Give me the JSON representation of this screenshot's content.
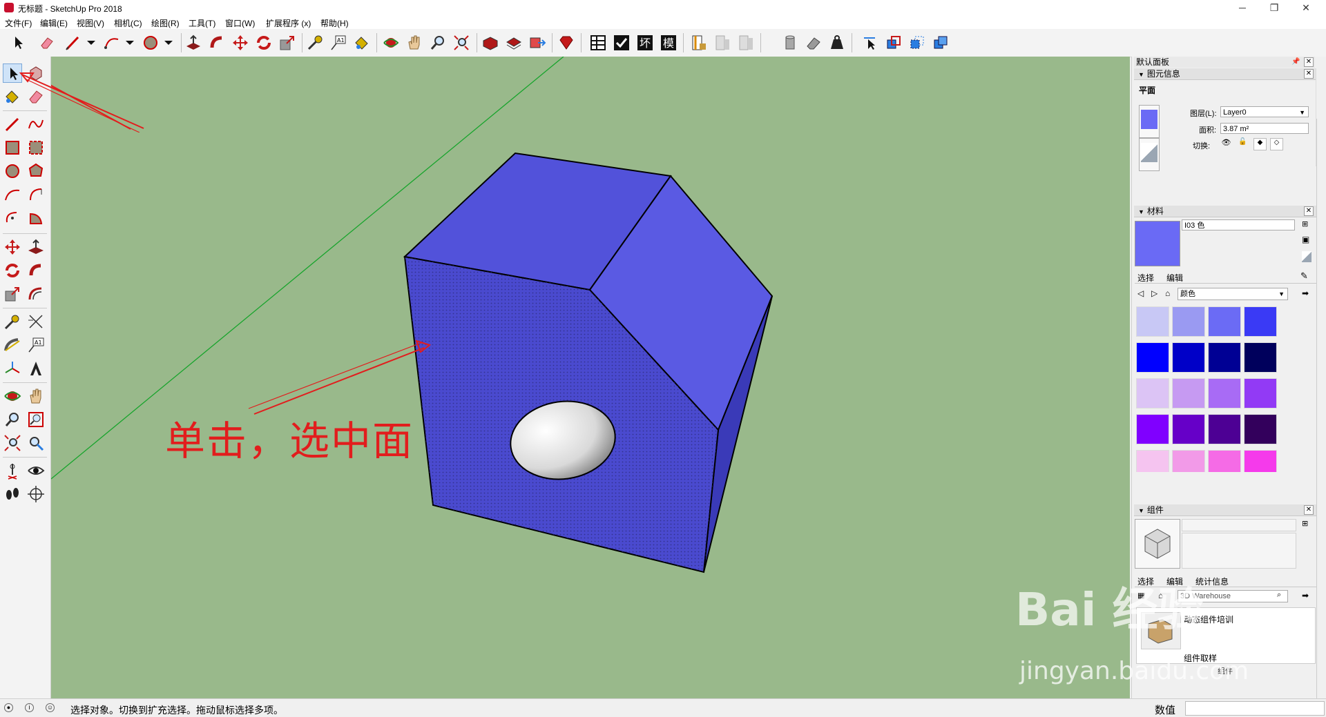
{
  "window": {
    "title": "无标题 - SketchUp Pro 2018",
    "minimize": "─",
    "maximize": "❐",
    "close": "✕"
  },
  "menu": [
    "文件(F)",
    "编辑(E)",
    "视图(V)",
    "相机(C)",
    "绘图(R)",
    "工具(T)",
    "窗口(W)",
    "扩展程序 (x)",
    "帮助(H)"
  ],
  "toolbar_text_icons": [
    "回",
    "坏",
    "模"
  ],
  "annotation": {
    "text": "单击，选中面"
  },
  "right_panel": {
    "title": "默认面板",
    "entity_info": {
      "header": "图元信息",
      "type": "平面",
      "layer_label": "图层(L):",
      "layer_value": "Layer0",
      "area_label": "面积:",
      "area_value": "3.87 m²",
      "toggle_label": "切换:"
    },
    "materials": {
      "header": "材料",
      "name_value": "I03 色",
      "tab_select": "选择",
      "tab_edit": "编辑",
      "collection": "颜色",
      "swatch_colors": [
        "#c8c8f5",
        "#9a9af2",
        "#6b6bf5",
        "#3a3af5",
        "#0000ff",
        "#0000c8",
        "#000094",
        "#00005c",
        "#dcc4f5",
        "#c69af2",
        "#a86bf5",
        "#923af5",
        "#8000ff",
        "#6600c8",
        "#4d0094",
        "#33005c",
        "#f5c4f0",
        "#f29ae8",
        "#f56be6",
        "#f53aeb",
        "#ff00ff",
        "#c800c8",
        "#940094",
        "#5c005c"
      ]
    },
    "components": {
      "header": "组件",
      "tab_select": "选择",
      "tab_edit": "编辑",
      "tab_stats": "统计信息",
      "search_value": "3D Warehouse",
      "item1": "动态组件培训",
      "item2": "组件取样",
      "footer": "组件"
    }
  },
  "status": {
    "text": "选择对象。切换到扩充选择。拖动鼠标选择多项。",
    "measure_label": "数值"
  },
  "watermark": {
    "main": "Bai 经验",
    "sub": "jingyan.baidu.com"
  },
  "colors": {
    "viewport_bg": "#99b98b",
    "face_front": "#4a4acf",
    "face_top": "#5252da",
    "face_right": "#5a5ae3",
    "face_side": "#3a3ab8",
    "annotation_red": "#e21d1d",
    "axis_green": "#16a42b"
  }
}
